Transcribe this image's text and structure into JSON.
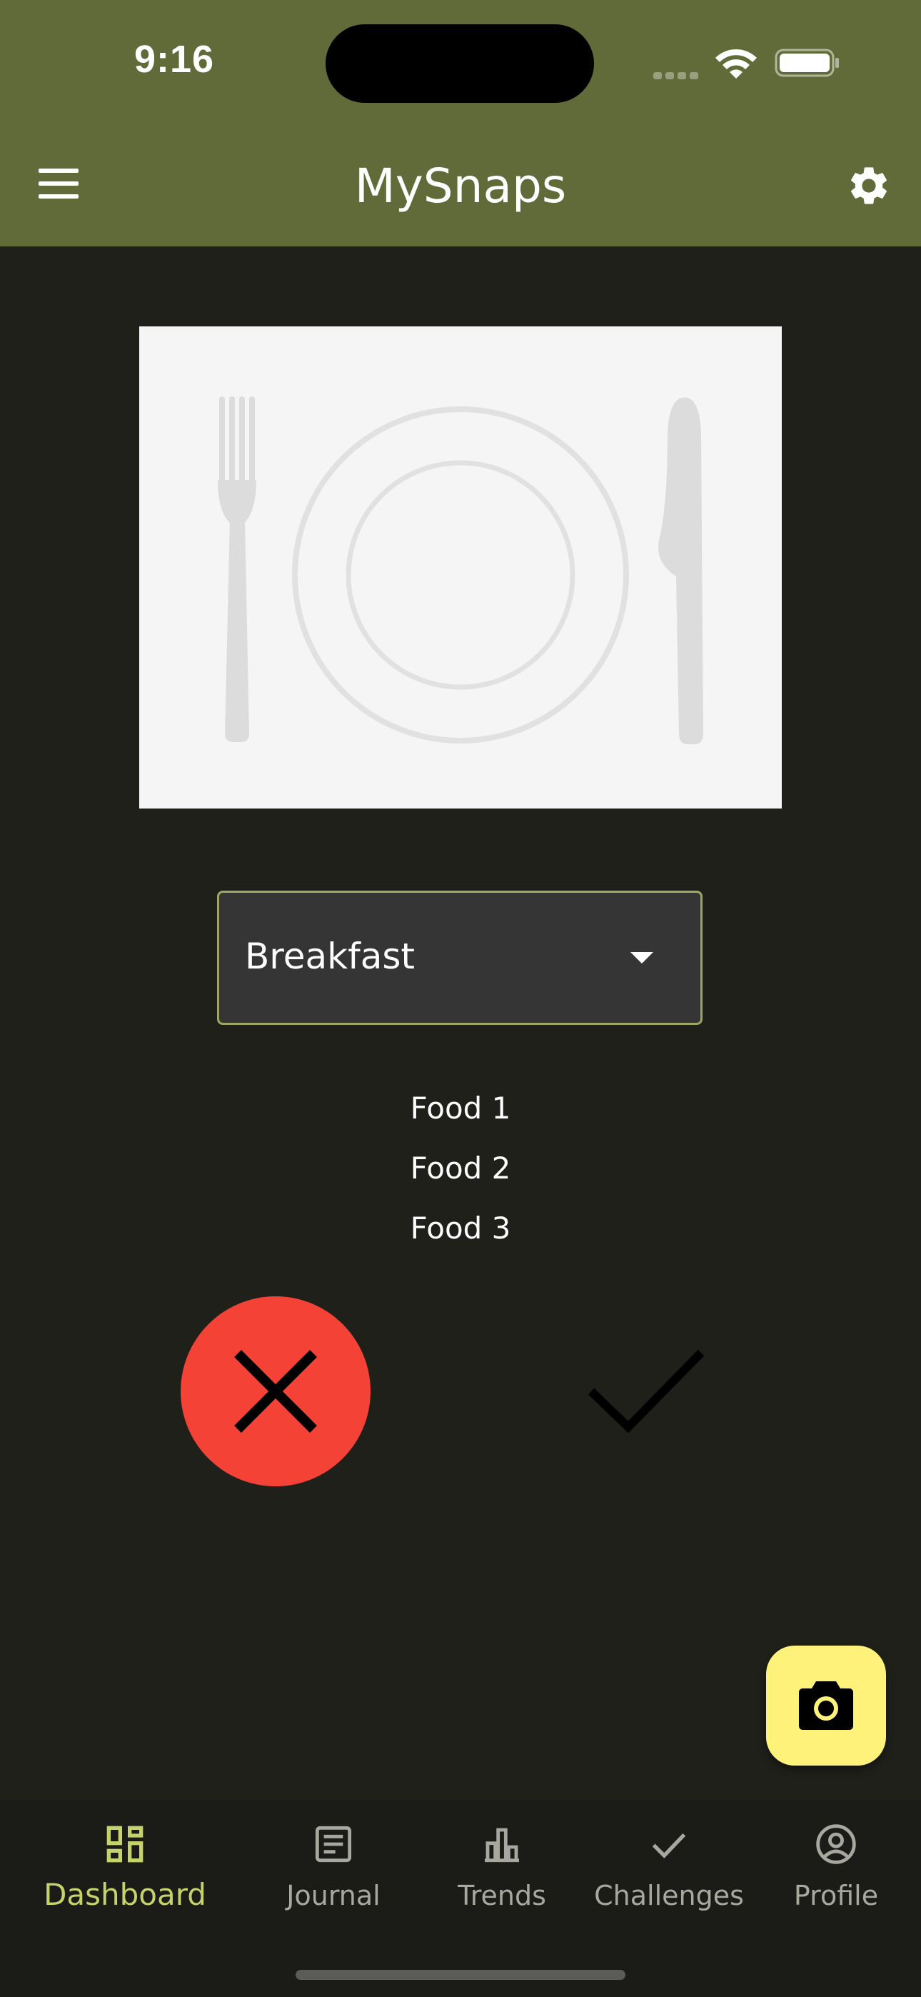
{
  "status_bar": {
    "time": "9:16"
  },
  "app_bar": {
    "title": "MySnaps",
    "menu_icon": "menu-icon",
    "settings_icon": "gear-icon"
  },
  "photo": {
    "placeholder_icon": "plate-with-utensils"
  },
  "meal_select": {
    "selected": "Breakfast"
  },
  "foods": [
    "Food 1",
    "Food 2",
    "Food 3"
  ],
  "actions": {
    "reject_icon": "close-icon",
    "accept_icon": "check-icon",
    "reject_color": "#f44336"
  },
  "fab": {
    "icon": "camera-icon",
    "color": "#fff27a"
  },
  "bottom_nav": {
    "items": [
      {
        "label": "Dashboard",
        "icon": "dashboard-icon",
        "active": true
      },
      {
        "label": "Journal",
        "icon": "journal-icon",
        "active": false
      },
      {
        "label": "Trends",
        "icon": "trends-icon",
        "active": false
      },
      {
        "label": "Challenges",
        "icon": "check-icon",
        "active": false
      },
      {
        "label": "Profile",
        "icon": "profile-icon",
        "active": false
      }
    ]
  },
  "colors": {
    "app_bar": "#616b39",
    "background": "#1f201a",
    "accent": "#c5d36a"
  }
}
